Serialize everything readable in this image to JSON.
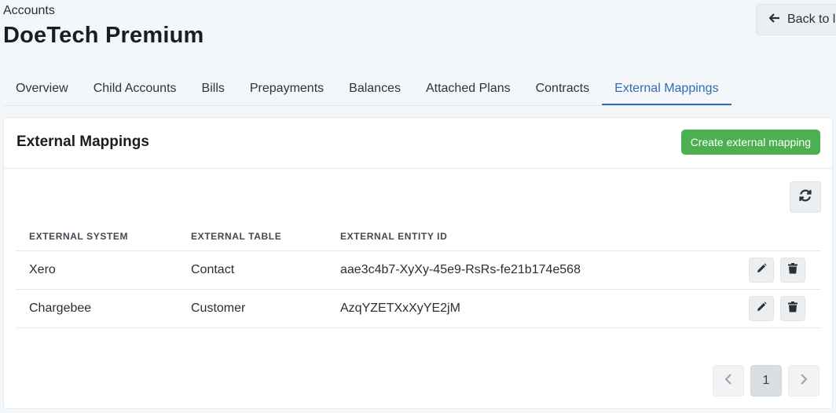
{
  "header": {
    "breadcrumb": "Accounts",
    "title": "DoeTech Premium",
    "back_label": "Back to l",
    "back_icon": "arrow-left-icon"
  },
  "tabs": [
    {
      "label": "Overview",
      "active": false
    },
    {
      "label": "Child Accounts",
      "active": false
    },
    {
      "label": "Bills",
      "active": false
    },
    {
      "label": "Prepayments",
      "active": false
    },
    {
      "label": "Balances",
      "active": false
    },
    {
      "label": "Attached Plans",
      "active": false
    },
    {
      "label": "Contracts",
      "active": false
    },
    {
      "label": "External Mappings",
      "active": true
    }
  ],
  "card": {
    "title": "External Mappings",
    "create_label": "Create external mapping",
    "refresh_icon": "refresh-icon"
  },
  "table": {
    "columns": [
      "External System",
      "External Table",
      "External Entity ID"
    ],
    "rows": [
      {
        "system": "Xero",
        "table": "Contact",
        "entity_id": "aae3c4b7-XyXy-45e9-RsRs-fe21b174e568"
      },
      {
        "system": "Chargebee",
        "table": "Customer",
        "entity_id": "AzqYZETXxXyYE2jM"
      }
    ]
  },
  "pagination": {
    "current_page": "1",
    "prev_icon": "chevron-left-icon",
    "next_icon": "chevron-right-icon"
  },
  "colors": {
    "accent": "#2f6db5",
    "create_button": "#4caf50",
    "background": "#f4f7fa"
  }
}
